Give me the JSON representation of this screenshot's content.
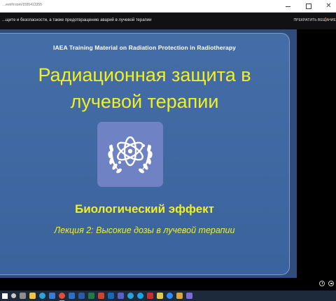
{
  "browser": {
    "url": "...eet#/room/1555413355"
  },
  "meeting": {
    "title": "...щите и безопасности, а также предотвращению аварий в лучевой терапии",
    "stop_share_label": "ПРЕКРАТИТЬ ВЕЩАНИЕ"
  },
  "slide": {
    "header": "IAEA Training Material on Radiation Protection in Radiotherapy",
    "title_line1": "Радиационная защита в",
    "title_line2": "лучевой терапии",
    "subtitle": "Биологический эффект",
    "lecture": "Лекция 2: Высокие дозы в лучевой терапии"
  },
  "colors": {
    "slide_bg": "#3d67a3",
    "title_text": "#f2ef22",
    "logo_bg": "#6f83c4",
    "meeting_bar": "#111114",
    "taskbar": "#1d2a3c"
  },
  "taskbar": {
    "icons": [
      {
        "name": "start-icon"
      },
      {
        "name": "search-icon"
      },
      {
        "name": "task-view-icon"
      },
      {
        "name": "file-explorer-icon"
      },
      {
        "name": "edge-icon"
      },
      {
        "name": "store-icon"
      },
      {
        "name": "chrome-icon"
      },
      {
        "name": "mail-icon"
      },
      {
        "name": "word-icon"
      },
      {
        "name": "excel-icon"
      },
      {
        "name": "powerpoint-icon"
      },
      {
        "name": "outlook-icon"
      },
      {
        "name": "teams-icon"
      },
      {
        "name": "telegram-icon"
      },
      {
        "name": "skype-icon"
      },
      {
        "name": "acrobat-icon"
      },
      {
        "name": "notes-icon"
      },
      {
        "name": "zoom-icon"
      },
      {
        "name": "folder-icon"
      },
      {
        "name": "photos-icon"
      }
    ]
  }
}
